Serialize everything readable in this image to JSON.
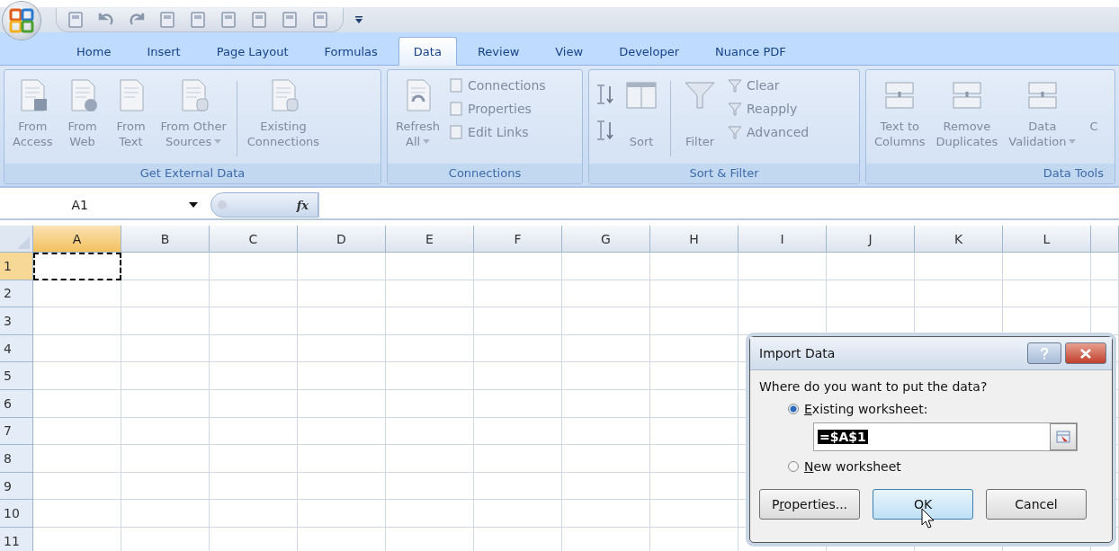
{
  "tabs": [
    {
      "label": "Home",
      "selected": false
    },
    {
      "label": "Insert",
      "selected": false
    },
    {
      "label": "Page Layout",
      "selected": false
    },
    {
      "label": "Formulas",
      "selected": false
    },
    {
      "label": "Data",
      "selected": true
    },
    {
      "label": "Review",
      "selected": false
    },
    {
      "label": "View",
      "selected": false
    },
    {
      "label": "Developer",
      "selected": false
    },
    {
      "label": "Nuance PDF",
      "selected": false
    }
  ],
  "ribbon_groups": [
    {
      "title": "Get External Data",
      "items": [
        {
          "kind": "large",
          "lines": [
            "From",
            "Access"
          ],
          "dropdown": false
        },
        {
          "kind": "large",
          "lines": [
            "From",
            "Web"
          ],
          "dropdown": false
        },
        {
          "kind": "large",
          "lines": [
            "From",
            "Text"
          ],
          "dropdown": false
        },
        {
          "kind": "large",
          "lines": [
            "From Other",
            "Sources"
          ],
          "dropdown": true
        },
        {
          "kind": "separator"
        },
        {
          "kind": "large",
          "lines": [
            "Existing",
            "Connections"
          ],
          "dropdown": false
        }
      ]
    },
    {
      "title": "Connections",
      "items": [
        {
          "kind": "large",
          "lines": [
            "Refresh",
            "All"
          ],
          "dropdown": true
        },
        {
          "kind": "small",
          "labels": [
            "Connections",
            "Properties",
            "Edit Links"
          ]
        }
      ]
    },
    {
      "title": "Sort & Filter",
      "items": [
        {
          "kind": "sortpair"
        },
        {
          "kind": "large",
          "lines": [
            "Sort"
          ],
          "dropdown": false
        },
        {
          "kind": "separator"
        },
        {
          "kind": "large",
          "lines": [
            "Filter"
          ],
          "dropdown": false
        },
        {
          "kind": "small",
          "labels": [
            "Clear",
            "Reapply",
            "Advanced"
          ]
        }
      ]
    },
    {
      "title": "Data Tools",
      "items": [
        {
          "kind": "large",
          "lines": [
            "Text to",
            "Columns"
          ],
          "dropdown": false
        },
        {
          "kind": "large",
          "lines": [
            "Remove",
            "Duplicates"
          ],
          "dropdown": false
        },
        {
          "kind": "large",
          "lines": [
            "Data",
            "Validation"
          ],
          "dropdown": true
        },
        {
          "kind": "cut",
          "lines": [
            "C"
          ]
        }
      ]
    }
  ],
  "name_box": "A1",
  "formula_label": "fx",
  "sheet": {
    "columns": [
      {
        "label": "A",
        "selected": true
      },
      {
        "label": "B",
        "selected": false
      },
      {
        "label": "C",
        "selected": false
      },
      {
        "label": "D",
        "selected": false
      },
      {
        "label": "E",
        "selected": false
      },
      {
        "label": "F",
        "selected": false
      },
      {
        "label": "G",
        "selected": false
      },
      {
        "label": "H",
        "selected": false
      },
      {
        "label": "I",
        "selected": false
      },
      {
        "label": "J",
        "selected": false
      },
      {
        "label": "K",
        "selected": false
      },
      {
        "label": "L",
        "selected": false
      }
    ],
    "rows": [
      {
        "label": "1",
        "selected": true
      },
      {
        "label": "2",
        "selected": false
      },
      {
        "label": "3",
        "selected": false
      },
      {
        "label": "4",
        "selected": false
      },
      {
        "label": "5",
        "selected": false
      },
      {
        "label": "6",
        "selected": false
      },
      {
        "label": "7",
        "selected": false
      },
      {
        "label": "8",
        "selected": false
      },
      {
        "label": "9",
        "selected": false
      },
      {
        "label": "10",
        "selected": false
      },
      {
        "label": "11",
        "selected": false
      }
    ]
  },
  "dialog": {
    "title": "Import Data",
    "prompt": "Where do you want to put the data?",
    "options": [
      {
        "underlined": "E",
        "rest": "xisting worksheet:",
        "selected": true
      },
      {
        "underlined": "N",
        "rest": "ew worksheet",
        "selected": false
      }
    ],
    "reference": "=$A$1",
    "buttons": [
      {
        "lead": "P",
        "underlined": "r",
        "rest": "operties...",
        "default": false
      },
      {
        "rest": "OK",
        "default": true
      },
      {
        "rest": "Cancel",
        "default": false
      }
    ]
  }
}
